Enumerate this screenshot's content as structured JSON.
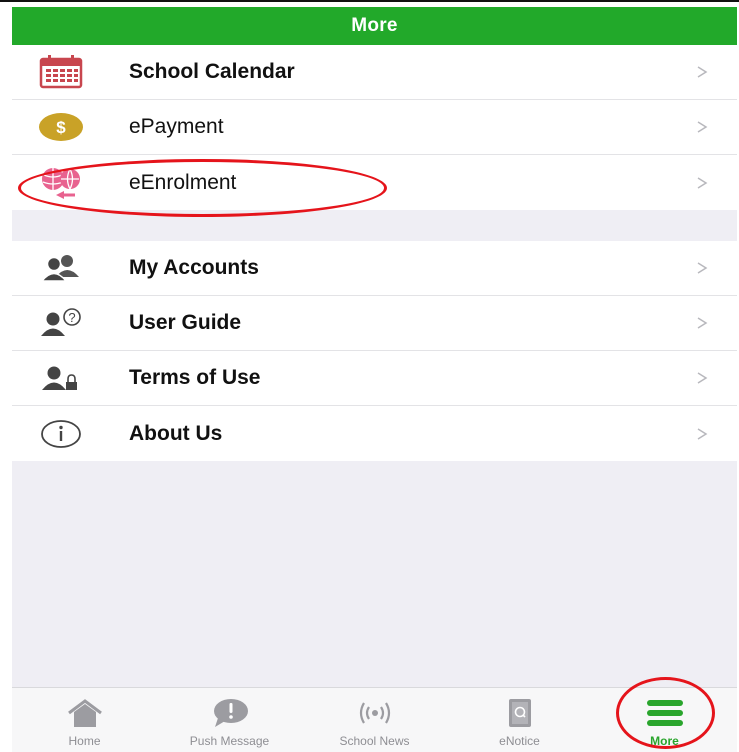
{
  "header": {
    "title": "More"
  },
  "colors": {
    "brand": "#22a92a",
    "annotation": "#e5141b"
  },
  "group1": [
    {
      "label": "School Calendar",
      "icon": "calendar-icon",
      "bold": true
    },
    {
      "label": "ePayment",
      "icon": "dollar-coin-icon",
      "bold": false
    },
    {
      "label": "eEnrolment",
      "icon": "sports-balls-icon",
      "bold": false
    }
  ],
  "group2": [
    {
      "label": "My Accounts",
      "icon": "users-icon",
      "bold": true
    },
    {
      "label": "User Guide",
      "icon": "user-question-icon",
      "bold": true
    },
    {
      "label": "Terms of Use",
      "icon": "user-lock-icon",
      "bold": true
    },
    {
      "label": "About Us",
      "icon": "info-icon",
      "bold": true
    }
  ],
  "tabs": [
    {
      "label": "Home",
      "icon": "home-icon",
      "active": false
    },
    {
      "label": "Push Message",
      "icon": "message-icon",
      "active": false
    },
    {
      "label": "School News",
      "icon": "broadcast-icon",
      "active": false
    },
    {
      "label": "eNotice",
      "icon": "notice-icon",
      "active": false
    },
    {
      "label": "More",
      "icon": "menu-icon",
      "active": true
    }
  ]
}
